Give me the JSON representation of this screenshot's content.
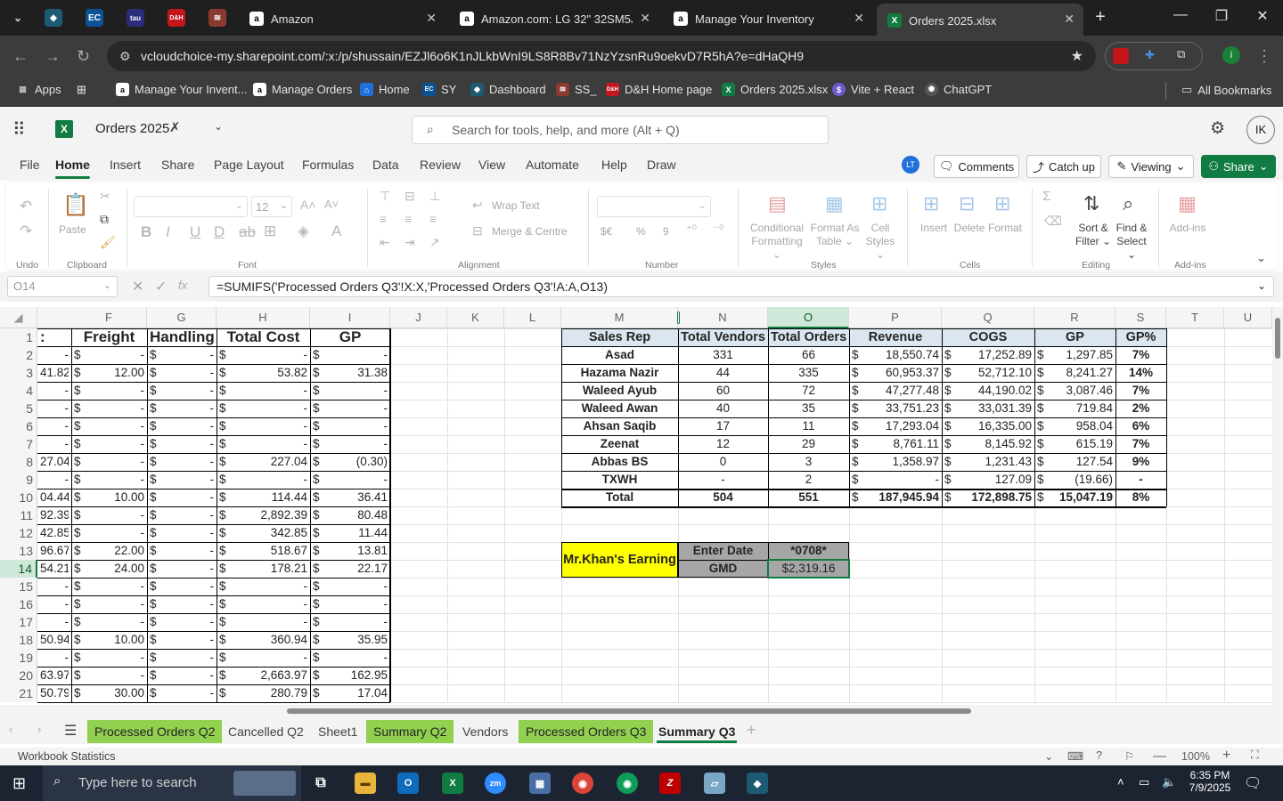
{
  "browser": {
    "tabs": [
      {
        "title": "Amazon",
        "icon": "a"
      },
      {
        "title": "Amazon.com: LG 32\" 32SM5J-B",
        "icon": "a"
      },
      {
        "title": "Manage Your Inventory",
        "icon": "a"
      },
      {
        "title": "Orders 2025.xlsx",
        "icon": "X"
      }
    ],
    "pinned": [
      "EC",
      "tau",
      "D&H"
    ],
    "url": "vcloudchoice-my.sharepoint.com/:x:/p/shussain/EZJl6o6K1nJLkbWnI9LS8R8Bv71NzYzsnRu9oekvD7R5hA?e=dHaQH9",
    "bookmarks": [
      "Apps",
      "Manage Your Invent...",
      "Manage Orders",
      "Home",
      "SY",
      "Dashboard",
      "SS_",
      "D&H Home page",
      "Orders 2025.xlsx",
      "Vite + React",
      "ChatGPT"
    ],
    "all_bookmarks": "All Bookmarks"
  },
  "excel": {
    "doc_title": "Orders 2025",
    "search_placeholder": "Search for tools, help, and more (Alt + Q)",
    "avatar": "IK",
    "presence": "LT",
    "menus": [
      "File",
      "Home",
      "Insert",
      "Share",
      "Page Layout",
      "Formulas",
      "Data",
      "Review",
      "View",
      "Automate",
      "Help",
      "Draw"
    ],
    "buttons": {
      "comments": "Comments",
      "catchup": "Catch up",
      "viewing": "Viewing",
      "share": "Share"
    },
    "ribbon": {
      "groups": [
        "Undo",
        "Clipboard",
        "Font",
        "Alignment",
        "Number",
        "Styles",
        "Cells",
        "Editing",
        "Add-ins"
      ],
      "paste": "Paste",
      "font_size": "12",
      "wrap": "Wrap Text",
      "merge": "Merge & Centre",
      "cond": "Conditional",
      "cond2": "Formatting",
      "fmt_table": "Format As",
      "fmt_table2": "Table",
      "cell_styles": "Cell",
      "cell_styles2": "Styles",
      "insert": "Insert",
      "delete": "Delete",
      "format": "Format",
      "sort": "Sort &",
      "sort2": "Filter",
      "find": "Find &",
      "find2": "Select",
      "addins": "Add-ins",
      "num": "$€",
      "pct": "%",
      "comma": "9"
    },
    "namebox": "O14",
    "formula": "=SUMIFS('Processed Orders Q3'!X:X,'Processed Orders Q3'!A:A,O13)",
    "columns": [
      "F",
      "G",
      "H",
      "I",
      "J",
      "K",
      "L",
      "M",
      "N",
      "O",
      "P",
      "Q",
      "R",
      "S",
      "T",
      "U"
    ],
    "rows": [
      "1",
      "2",
      "3",
      "4",
      "5",
      "6",
      "7",
      "8",
      "9",
      "10",
      "11",
      "12",
      "13",
      "14",
      "15",
      "16",
      "17",
      "18",
      "19",
      "20",
      "21"
    ],
    "left_headers": {
      "e": ":",
      "f": "Freight",
      "g": "Handling",
      "h": "Total Cost",
      "i": "GP"
    },
    "left_rows": [
      [
        "-",
        "-",
        "-",
        "-",
        "-"
      ],
      [
        "41.82",
        "12.00",
        "-",
        "53.82",
        "31.38"
      ],
      [
        "-",
        "-",
        "-",
        "-",
        "-"
      ],
      [
        "-",
        "-",
        "-",
        "-",
        "-"
      ],
      [
        "-",
        "-",
        "-",
        "-",
        "-"
      ],
      [
        "-",
        "-",
        "-",
        "-",
        "-"
      ],
      [
        "27.04",
        "-",
        "-",
        "227.04",
        "(0.30)"
      ],
      [
        "-",
        "-",
        "-",
        "-",
        "-"
      ],
      [
        "04.44",
        "10.00",
        "-",
        "114.44",
        "36.41"
      ],
      [
        "92.39",
        "-",
        "-",
        "2,892.39",
        "80.48"
      ],
      [
        "42.85",
        "-",
        "-",
        "342.85",
        "11.44"
      ],
      [
        "96.67",
        "22.00",
        "-",
        "518.67",
        "13.81"
      ],
      [
        "54.21",
        "24.00",
        "-",
        "178.21",
        "22.17"
      ],
      [
        "-",
        "-",
        "-",
        "-",
        "-"
      ],
      [
        "-",
        "-",
        "-",
        "-",
        "-"
      ],
      [
        "-",
        "-",
        "-",
        "-",
        "-"
      ],
      [
        "50.94",
        "10.00",
        "-",
        "360.94",
        "35.95"
      ],
      [
        "-",
        "-",
        "-",
        "-",
        "-"
      ],
      [
        "63.97",
        "-",
        "-",
        "2,663.97",
        "162.95"
      ],
      [
        "50.79",
        "30.00",
        "-",
        "280.79",
        "17.04"
      ]
    ],
    "summary_headers": [
      "Sales Rep",
      "Total Vendors",
      "Total Orders",
      "Revenue",
      "COGS",
      "GP",
      "GP%"
    ],
    "summary_rows": [
      [
        "Asad",
        "331",
        "66",
        "18,550.74",
        "17,252.89",
        "1,297.85",
        "7%"
      ],
      [
        "Hazama Nazir",
        "44",
        "335",
        "60,953.37",
        "52,712.10",
        "8,241.27",
        "14%"
      ],
      [
        "Waleed Ayub",
        "60",
        "72",
        "47,277.48",
        "44,190.02",
        "3,087.46",
        "7%"
      ],
      [
        "Waleed Awan",
        "40",
        "35",
        "33,751.23",
        "33,031.39",
        "719.84",
        "2%"
      ],
      [
        "Ahsan Saqib",
        "17",
        "11",
        "17,293.04",
        "16,335.00",
        "958.04",
        "6%"
      ],
      [
        "Zeenat",
        "12",
        "29",
        "8,761.11",
        "8,145.92",
        "615.19",
        "7%"
      ],
      [
        "Abbas BS",
        "0",
        "3",
        "1,358.97",
        "1,231.43",
        "127.54",
        "9%"
      ],
      [
        "TXWH",
        "-",
        "2",
        "-",
        "127.09",
        "(19.66)",
        "-"
      ],
      [
        "Total",
        "504",
        "551",
        "187,945.94",
        "172,898.75",
        "15,047.19",
        "8%"
      ]
    ],
    "currency": "$",
    "earning": {
      "label": "Mr.Khan's Earning",
      "enter_date": "Enter Date",
      "date_value": "*0708*",
      "gmd": "GMD",
      "gmd_value": "$2,319.16"
    },
    "sheets": [
      "Processed Orders Q2",
      "Cancelled Q2",
      "Sheet1",
      "Summary Q2",
      "Vendors",
      "Processed Orders Q3",
      "Summary Q3"
    ],
    "status": "Workbook Statistics",
    "zoom": "100%"
  },
  "taskbar": {
    "search": "Type here to search",
    "time": "6:35 PM",
    "date": "7/9/2025"
  },
  "colors": {
    "excel_green": "#107c41",
    "sheet_green": "#92d050",
    "yellow": "#ffff00",
    "header_blue": "#dce6f1",
    "earning_gray": "#a6a6a6"
  }
}
